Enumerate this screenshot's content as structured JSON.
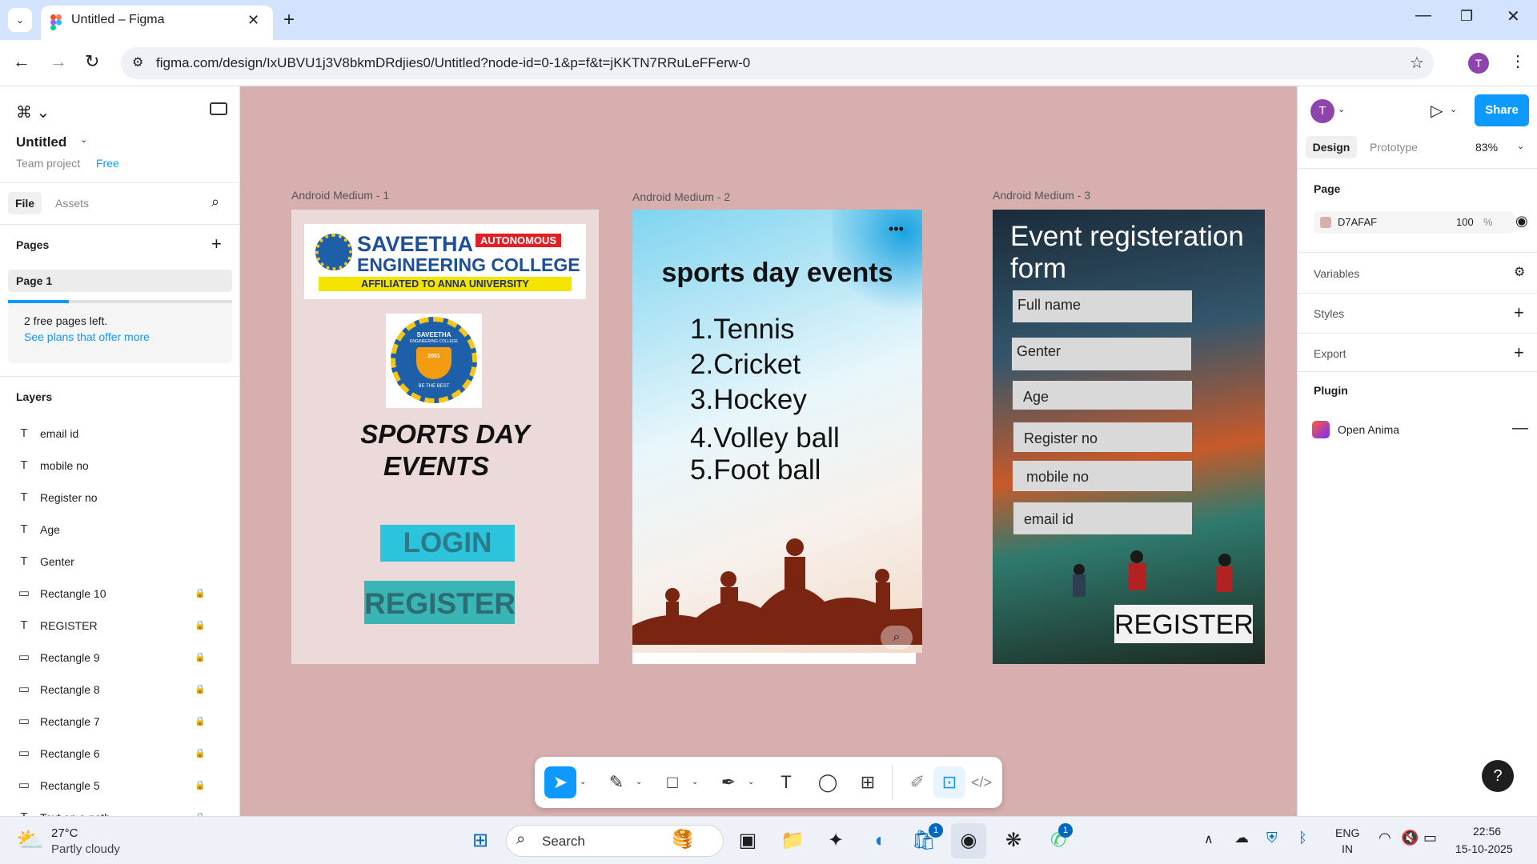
{
  "browser": {
    "tab_title": "Untitled – Figma",
    "new_tab": "+",
    "url": "figma.com/design/IxUBVU1j3V8bkmDRdjies0/Untitled?node-id=0-1&p=f&t=jKKTN7RRuLeFFerw-0",
    "profile_initial": "T",
    "window_controls": [
      "minimize-icon",
      "restore-icon",
      "close-icon"
    ]
  },
  "left_panel": {
    "file_name": "Untitled",
    "project": "Team project",
    "plan": "Free",
    "tabs": [
      "File",
      "Assets"
    ],
    "pages_title": "Pages",
    "pages": [
      "Page 1"
    ],
    "notice": "2 free pages left.",
    "notice_link": "See plans that offer more",
    "layers_title": "Layers",
    "layers": [
      {
        "name": "email id",
        "type": "text",
        "locked": false
      },
      {
        "name": "mobile no",
        "type": "text",
        "locked": false
      },
      {
        "name": "Register no",
        "type": "text",
        "locked": false
      },
      {
        "name": "Age",
        "type": "text",
        "locked": false
      },
      {
        "name": "Genter",
        "type": "text",
        "locked": false
      },
      {
        "name": "Rectangle 10",
        "type": "rect",
        "locked": true
      },
      {
        "name": "REGISTER",
        "type": "text",
        "locked": true
      },
      {
        "name": "Rectangle 9",
        "type": "rect",
        "locked": true
      },
      {
        "name": "Rectangle 8",
        "type": "rect",
        "locked": true
      },
      {
        "name": "Rectangle 7",
        "type": "rect",
        "locked": true
      },
      {
        "name": "Rectangle 6",
        "type": "rect",
        "locked": true
      },
      {
        "name": "Rectangle 5",
        "type": "rect",
        "locked": true
      },
      {
        "name": "Text on a path",
        "type": "text",
        "locked": true
      }
    ]
  },
  "canvas": {
    "frame1": {
      "label": "Android Medium - 1",
      "college_line1": "SAVEETHA",
      "college_line2": "ENGINEERING COLLEGE",
      "autonomous": "AUTONOMOUS",
      "affiliated": "AFFILIATED TO ANNA UNIVERSITY",
      "seal_top": "SAVEETHA",
      "seal_sub": "ENGINEERING COLLEGE",
      "seal_year": "2001",
      "seal_motto": "BE THE BEST",
      "title_line1": "SPORTS DAY",
      "title_line2": "EVENTS",
      "login": "LOGIN",
      "register": "REGISTER"
    },
    "frame2": {
      "label": "Android Medium - 2",
      "title": "sports day events",
      "events": [
        "1.Tennis",
        "2.Cricket",
        "3.Hockey",
        "4.Volley ball",
        "5.Foot ball"
      ],
      "more": "•••"
    },
    "frame3": {
      "label": "Android Medium - 3",
      "title_line1": "Event registeration",
      "title_line2": "form",
      "fields": [
        "Full name",
        "Genter",
        "Age",
        "Register no",
        "mobile no",
        "email id"
      ],
      "register": "REGISTER"
    }
  },
  "right_panel": {
    "avatar": "T",
    "share": "Share",
    "tabs": [
      "Design",
      "Prototype"
    ],
    "zoom": "83%",
    "page_title": "Page",
    "bg_color": "D7AFAF",
    "bg_color_hex": "#d7afaf",
    "opacity": "100",
    "opacity_unit": "%",
    "sections": [
      "Variables",
      "Styles",
      "Export"
    ],
    "plugin_title": "Plugin",
    "plugin_name": "Open Anima",
    "help": "?"
  },
  "taskbar": {
    "temp": "27°C",
    "weather": "Partly cloudy",
    "search": "Search",
    "lang1": "ENG",
    "lang2": "IN",
    "time": "22:56",
    "date": "15-10-2025",
    "store_badge": "1",
    "whatsapp_badge": "1"
  },
  "colors": {
    "accent": "#0d99ff",
    "canvas": "#d7afaf",
    "cyan": "#2bc4dc",
    "teal": "#3ab5b5"
  }
}
